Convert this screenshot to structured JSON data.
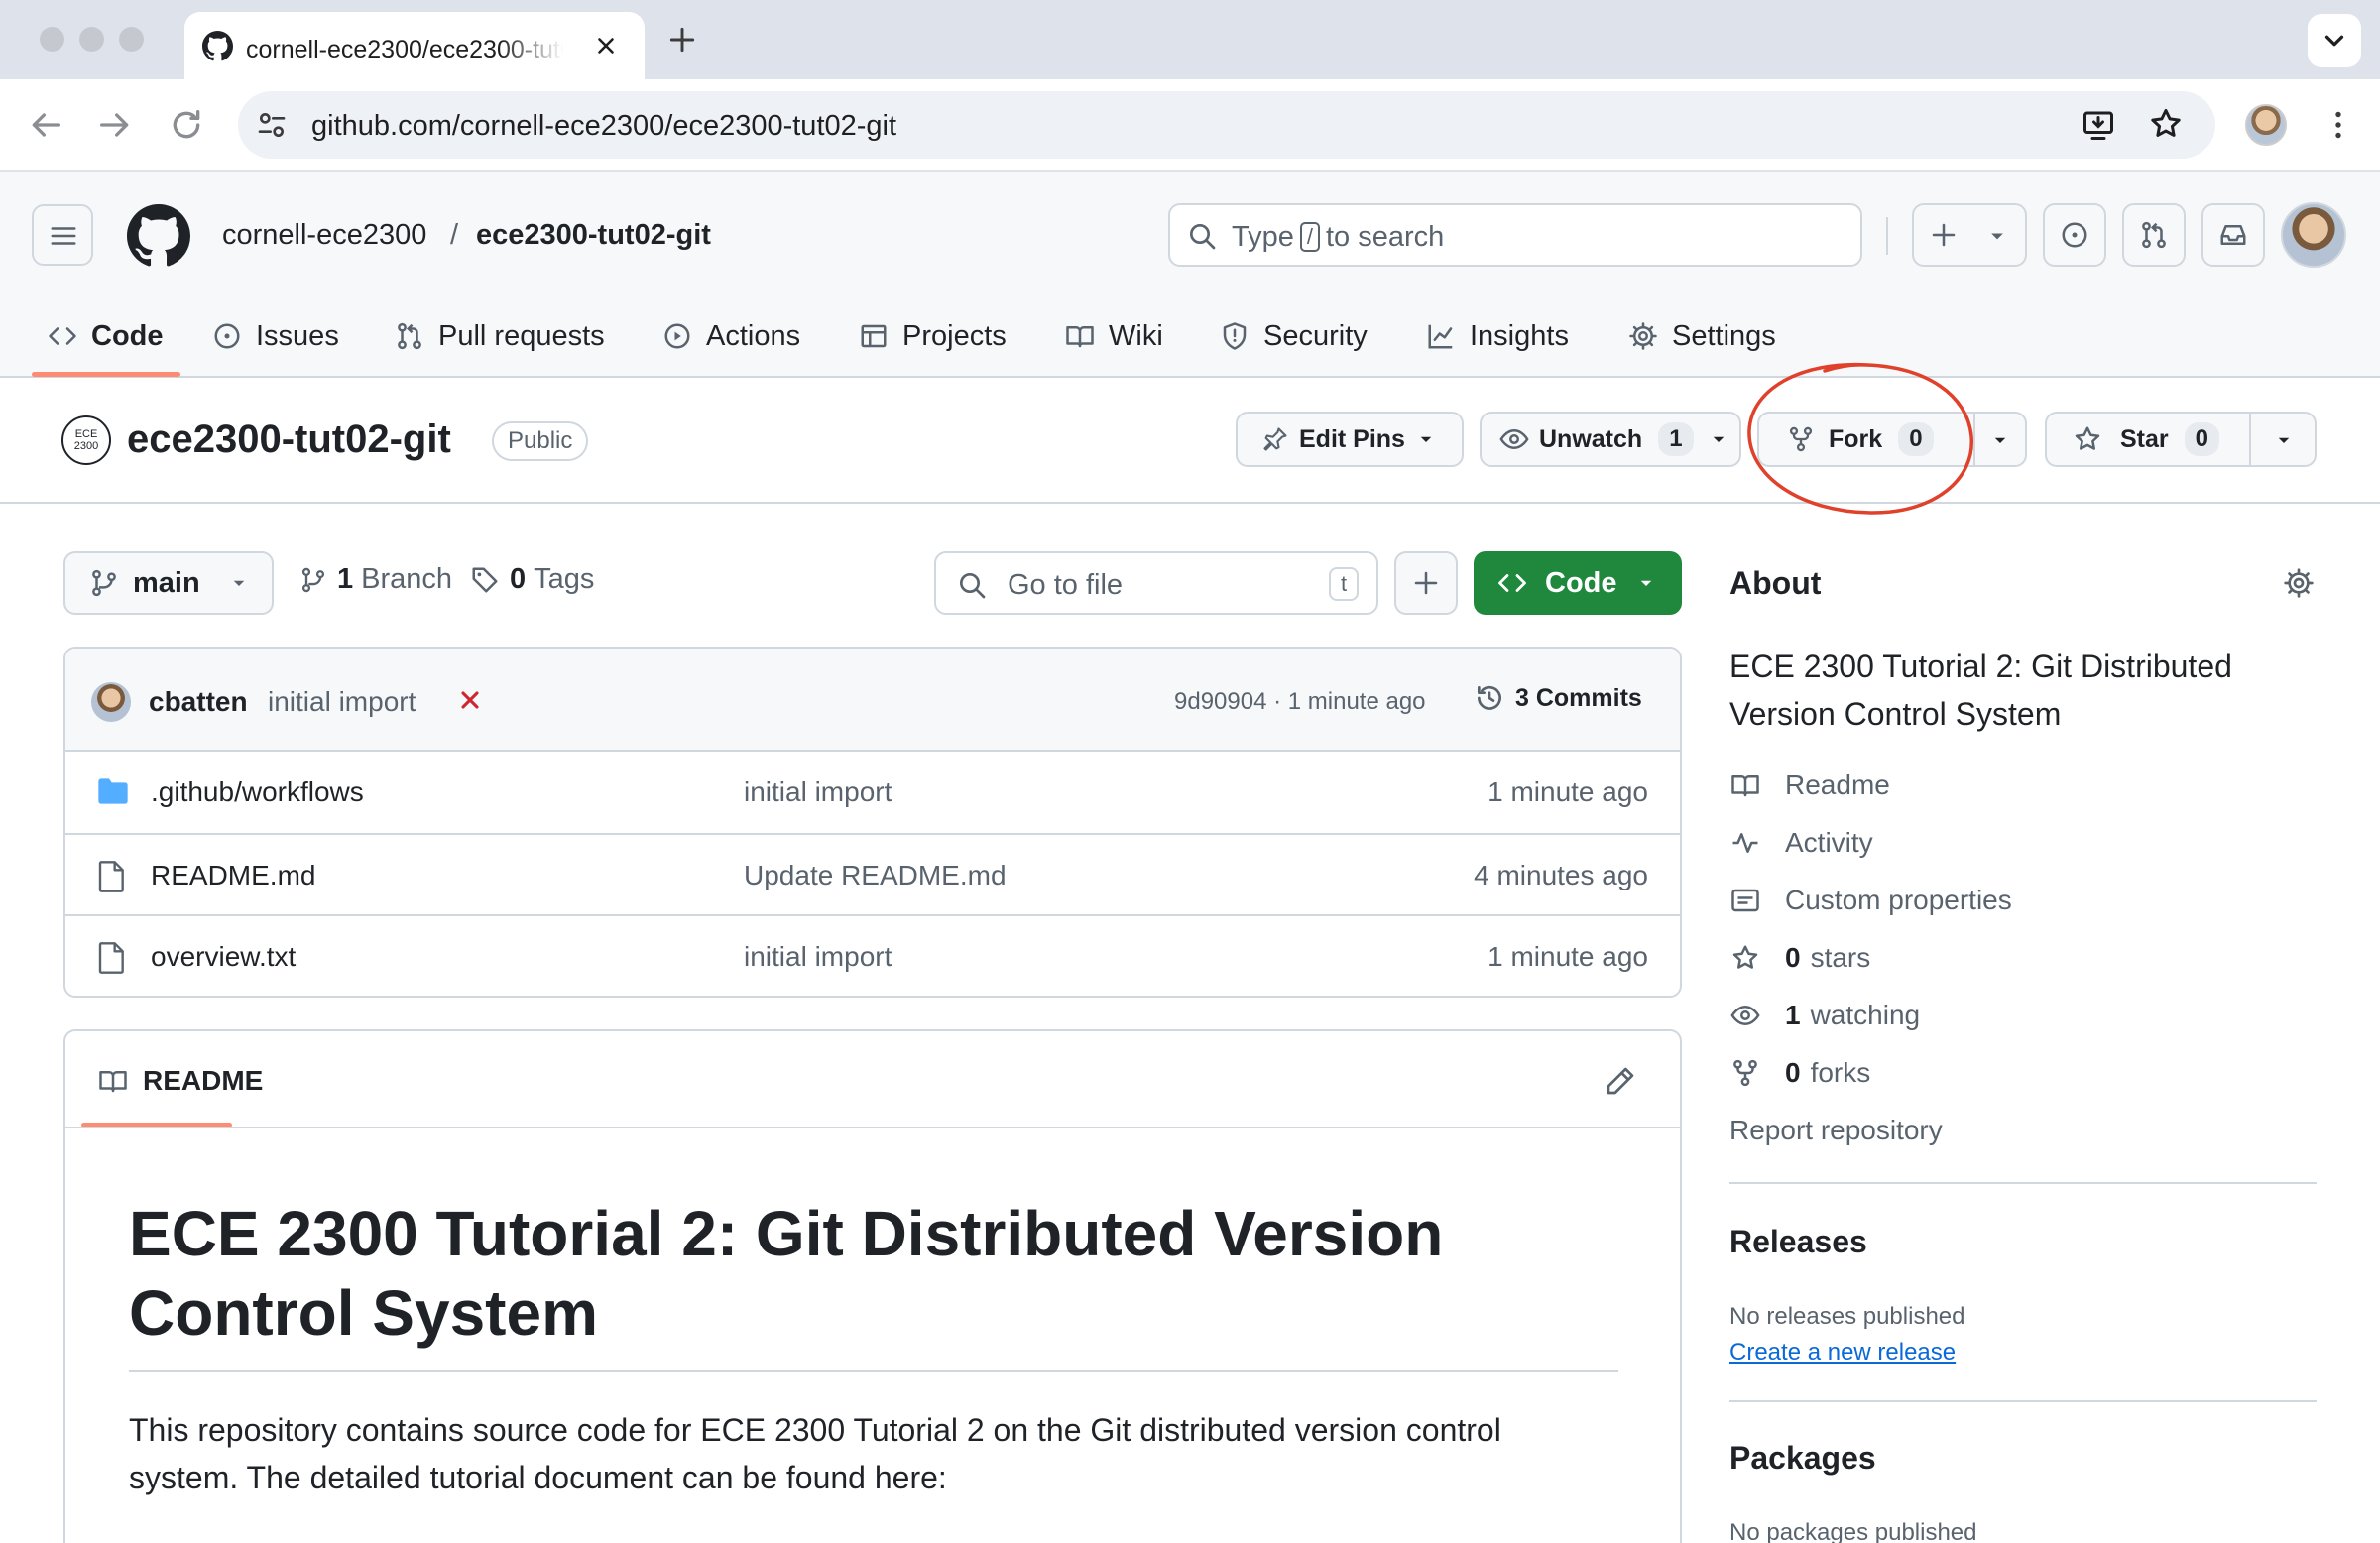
{
  "browser": {
    "tab_title": "cornell-ece2300/ece2300-tut02-git",
    "url": "github.com/cornell-ece2300/ece2300-tut02-git"
  },
  "header": {
    "owner": "cornell-ece2300",
    "separator": "/",
    "repo": "ece2300-tut02-git",
    "search_prefix": "Type",
    "search_key": "/",
    "search_suffix": "to search"
  },
  "repo_nav": [
    {
      "label": "Code",
      "icon": "code-icon",
      "active": true
    },
    {
      "label": "Issues",
      "icon": "issue-icon"
    },
    {
      "label": "Pull requests",
      "icon": "pull-request-icon"
    },
    {
      "label": "Actions",
      "icon": "play-icon"
    },
    {
      "label": "Projects",
      "icon": "table-icon"
    },
    {
      "label": "Wiki",
      "icon": "book-icon"
    },
    {
      "label": "Security",
      "icon": "shield-icon"
    },
    {
      "label": "Insights",
      "icon": "graph-icon"
    },
    {
      "label": "Settings",
      "icon": "gear-icon"
    }
  ],
  "repo_head": {
    "logo_text": "ECE 2300",
    "title": "ece2300-tut02-git",
    "visibility": "Public",
    "edit_pins": "Edit Pins",
    "watch_label": "Unwatch",
    "watch_count": "1",
    "fork_label": "Fork",
    "fork_count": "0",
    "star_label": "Star",
    "star_count": "0"
  },
  "toolbar": {
    "branch": "main",
    "branches_count": "1",
    "branches_label": "Branch",
    "tags_count": "0",
    "tags_label": "Tags",
    "go_to_file": "Go to file",
    "go_to_file_key": "t",
    "code_button": "Code"
  },
  "latest_commit": {
    "author": "cbatten",
    "message": "initial import",
    "sha_time": "9d90904 · 1 minute ago",
    "commits": "3 Commits"
  },
  "files": [
    {
      "name": ".github/workflows",
      "type": "folder",
      "message": "initial import",
      "age": "1 minute ago"
    },
    {
      "name": "README.md",
      "type": "file",
      "message": "Update README.md",
      "age": "4 minutes ago"
    },
    {
      "name": "overview.txt",
      "type": "file",
      "message": "initial import",
      "age": "1 minute ago"
    }
  ],
  "readme": {
    "tab": "README",
    "heading": "ECE 2300 Tutorial 2: Git Distributed Version Control System",
    "paragraph": "This repository contains source code for ECE 2300 Tutorial 2 on the Git distributed version control system. The detailed tutorial document can be found here:"
  },
  "sidebar": {
    "about_title": "About",
    "description": "ECE 2300 Tutorial 2: Git Distributed Version Control System",
    "links": {
      "readme": "Readme",
      "activity": "Activity",
      "custom_properties": "Custom properties",
      "stars_count": "0",
      "stars_label": "stars",
      "watching_count": "1",
      "watching_label": "watching",
      "forks_count": "0",
      "forks_label": "forks",
      "report": "Report repository"
    },
    "releases_title": "Releases",
    "releases_empty": "No releases published",
    "create_release": "Create a new release",
    "packages_title": "Packages",
    "packages_empty": "No packages published"
  },
  "colors": {
    "accent_underline": "#fd8c73",
    "code_button": "#1f883d",
    "annotation_circle": "#e0412b",
    "link": "#0969da"
  }
}
